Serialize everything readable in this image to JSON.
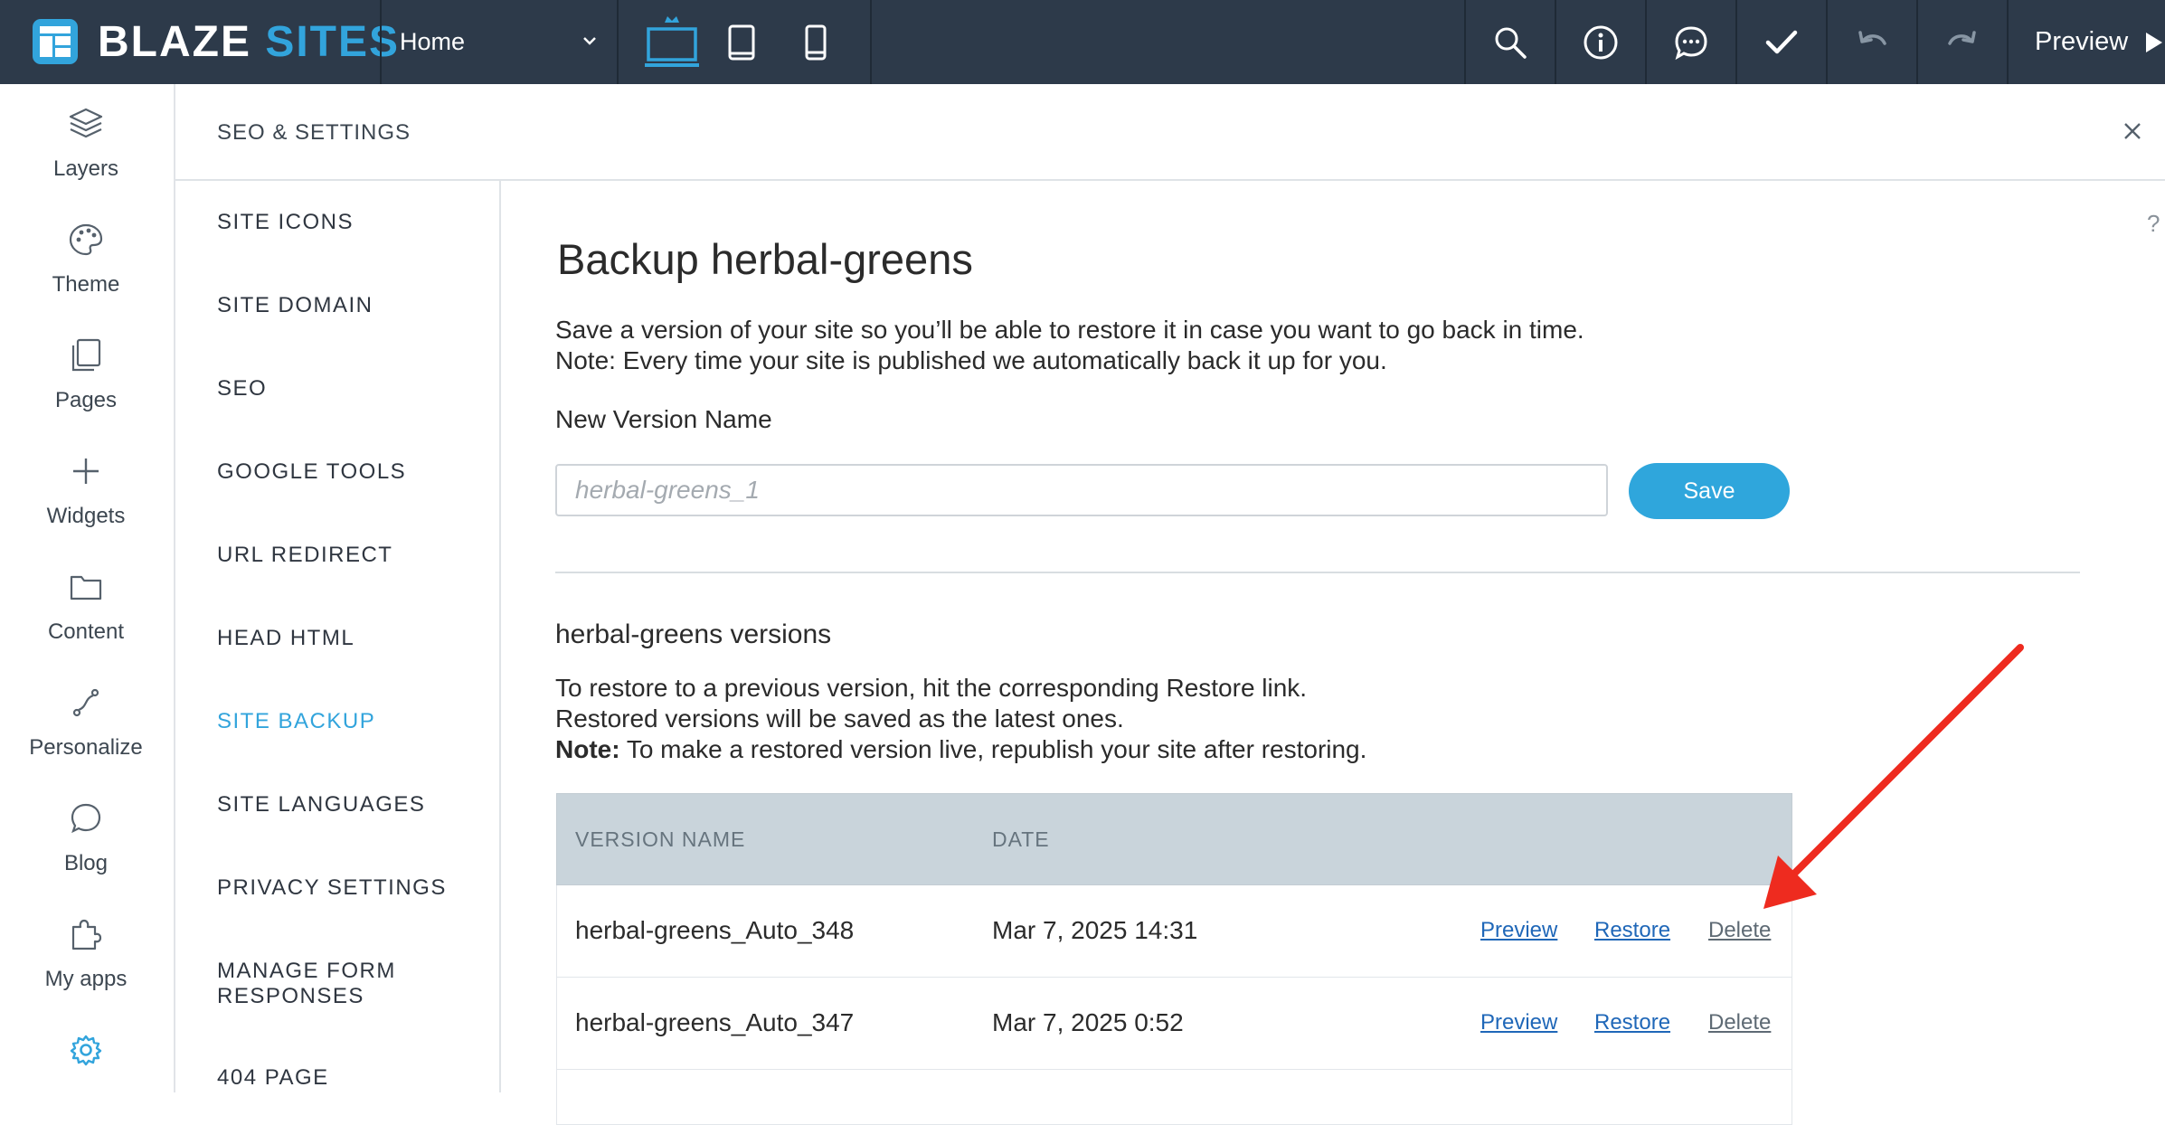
{
  "app": {
    "logo_word1": "BLAZE",
    "logo_word2": "SITES",
    "brand_color": "#32a4dc",
    "topbar_color": "#2d3a4a"
  },
  "topbar": {
    "page_selector_value": "Home",
    "devices": [
      "desktop-icon",
      "tablet-icon",
      "mobile-icon"
    ],
    "active_device": "desktop",
    "tools": [
      "search-icon",
      "info-icon",
      "chat-icon",
      "check-icon",
      "undo-icon",
      "redo-icon"
    ],
    "preview_label": "Preview"
  },
  "rail": {
    "items": [
      {
        "label": "Layers",
        "icon": "layers-icon"
      },
      {
        "label": "Theme",
        "icon": "palette-icon"
      },
      {
        "label": "Pages",
        "icon": "pages-icon"
      },
      {
        "label": "Widgets",
        "icon": "plus-icon"
      },
      {
        "label": "Content",
        "icon": "folder-icon"
      },
      {
        "label": "Personalize",
        "icon": "personalize-icon"
      },
      {
        "label": "Blog",
        "icon": "blog-icon"
      },
      {
        "label": "My apps",
        "icon": "puzzle-icon"
      }
    ],
    "settings_icon": "gear-icon"
  },
  "panel": {
    "title": "SEO & SETTINGS",
    "help": "?",
    "nav": [
      "SITE ICONS",
      "SITE DOMAIN",
      "SEO",
      "GOOGLE TOOLS",
      "URL REDIRECT",
      "HEAD HTML",
      "SITE BACKUP",
      "SITE LANGUAGES",
      "PRIVACY SETTINGS",
      "MANAGE FORM RESPONSES",
      "404 PAGE"
    ],
    "active_nav": "SITE BACKUP"
  },
  "backup": {
    "title": "Backup herbal-greens",
    "desc_line1": "Save a version of your site so you’ll be able to restore it in case you want to go back in time.",
    "desc_line2": "Note: Every time your site is published we automatically back it up for you.",
    "new_version_label": "New Version Name",
    "new_version_placeholder": "herbal-greens_1",
    "save_label": "Save",
    "versions_site": "herbal-greens",
    "versions_suffix": " versions",
    "restore_line1": "To restore to a previous version, hit the corresponding Restore link.",
    "restore_line2": "Restored versions will be saved as the latest ones.",
    "note_bold": "Note:",
    "note_text": " To make a restored version live, republish your site after restoring.",
    "table": {
      "col_name": "VERSION NAME",
      "col_date": "DATE",
      "rows": [
        {
          "name": "herbal-greens_Auto_348",
          "date": "Mar 7, 2025 14:31",
          "preview": "Preview",
          "restore": "Restore",
          "delete": "Delete"
        },
        {
          "name": "herbal-greens_Auto_347",
          "date": "Mar 7, 2025 0:52",
          "preview": "Preview",
          "restore": "Restore",
          "delete": "Delete"
        }
      ]
    }
  },
  "annotation": {
    "type": "arrow",
    "color": "#ee2b1f",
    "points_to": "Delete"
  }
}
